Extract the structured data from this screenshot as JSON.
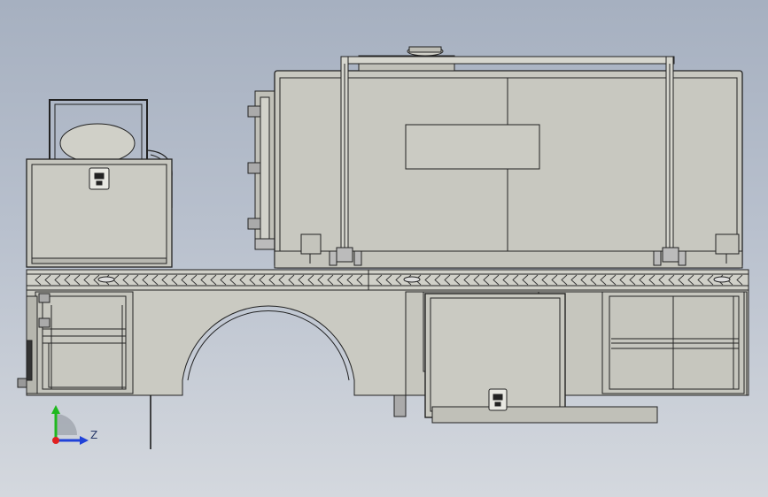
{
  "viewport": {
    "background_top": "#a6b0c0",
    "background_bottom": "#d4d8de",
    "model_fill": "#c8c8c0",
    "model_fill_light": "#d2d2cb",
    "model_edge": "#222222"
  },
  "triad": {
    "label_z": "Z",
    "x_axis_color": "#e02020",
    "y_axis_color": "#1fb81f",
    "z_axis_color": "#2042d8"
  },
  "icons": {
    "triad": "coordinate-triad-icon",
    "latch": "latch-icon"
  }
}
